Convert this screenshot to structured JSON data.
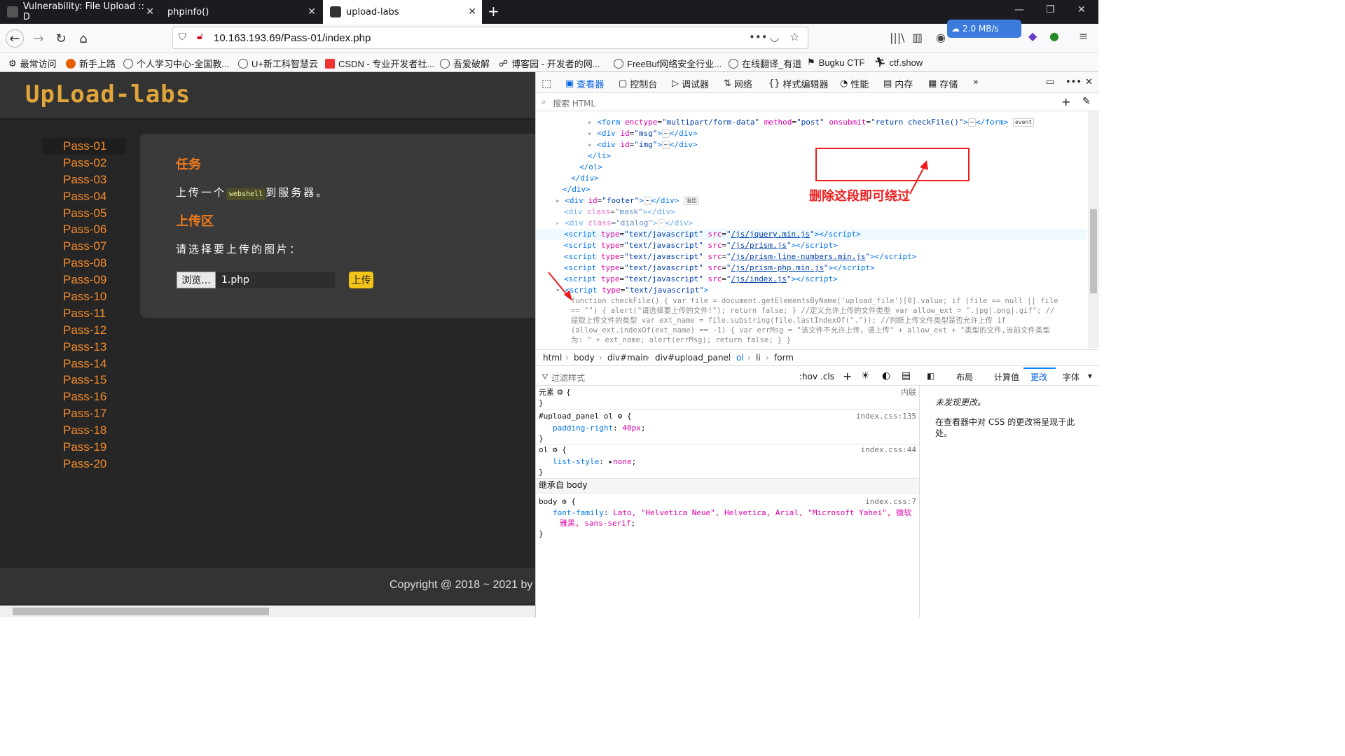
{
  "tabs": [
    {
      "label": "Vulnerability: File Upload :: D"
    },
    {
      "label": "phpinfo()"
    },
    {
      "label": "upload-labs"
    }
  ],
  "url": "10.163.193.69/Pass-01/index.php",
  "speed_badge": "2.0 MB/s",
  "bookmarks": [
    "最常访问",
    "新手上路",
    "个人学习中心-全国教...",
    "U+新工科智慧云",
    "CSDN - 专业开发者社...",
    "吾爱破解",
    "博客园 - 开发者的网...",
    "FreeBuf网络安全行业...",
    "在线翻译_有道",
    "Bugku CTF",
    "ctf.show"
  ],
  "site": {
    "logo": "UpLoad-labs",
    "passes": [
      "Pass-01",
      "Pass-02",
      "Pass-03",
      "Pass-04",
      "Pass-05",
      "Pass-06",
      "Pass-07",
      "Pass-08",
      "Pass-09",
      "Pass-10",
      "Pass-11",
      "Pass-12",
      "Pass-13",
      "Pass-14",
      "Pass-15",
      "Pass-16",
      "Pass-17",
      "Pass-18",
      "Pass-19",
      "Pass-20"
    ],
    "task_heading": "任务",
    "task_pre": "上传一个",
    "task_code": "webshell",
    "task_post": "到服务器。",
    "upload_heading": "上传区",
    "choose_label": "请选择要上传的图片：",
    "browse_label": "浏览...",
    "file_name": "1.php",
    "upload_button": "上传",
    "copyright": "Copyright @ 2018 ~ 2021 by"
  },
  "devtools": {
    "tools": [
      "查看器",
      "控制台",
      "调试器",
      "网络",
      "样式编辑器",
      "性能",
      "内存",
      "存储"
    ],
    "search_placeholder": "搜索 HTML",
    "annotation": "删除这段即可绕过",
    "breadcrumbs": [
      "html",
      "body",
      "div#main",
      "div#upload_panel",
      "ol",
      "li",
      "form"
    ],
    "filter_placeholder": "过滤样式",
    "hov": ":hov",
    "cls": ".cls",
    "right_tabs": [
      "布局",
      "计算值",
      "更改",
      "字体"
    ],
    "no_changes": "未发现更改。",
    "changes_hint": "在查看器中对 CSS 的更改将呈现于此处。",
    "inherit": "继承自 body",
    "element_label": "元素",
    "inline": "内联",
    "rule1_sel": "#upload_panel ol",
    "rule1_src": "index.css:135",
    "rule1_prop": "padding-right",
    "rule1_val": "40px",
    "rule2_sel": "ol",
    "rule2_src": "index.css:44",
    "rule2_prop": "list-style",
    "rule2_val": "none",
    "rule3_sel": "body",
    "rule3_src": "index.css:7",
    "rule3_prop": "font-family",
    "rule3_val1": "Lato, \"Helvetica Neue\", Helvetica, Arial, \"Microsoft Yahei\", 微软",
    "rule3_val2": "雅黑, sans-serif",
    "js_line1": "function checkFile() { var file = document.getElementsByName('upload_file')[0].value; if (file == null || file",
    "js_line2": "== \"\") { alert(\"请选择要上传的文件!\"); return false; } //定义允许上传的文件类型 var allow_ext = \".jpg|.png|.gif\"; //",
    "js_line3": "提取上传文件的类型 var ext_name = file.substring(file.lastIndexOf(\".\")); //判断上传文件类型是否允许上传 if",
    "js_line4": "(allow_ext.indexOf(ext_name) == -1) { var errMsg = \"该文件不允许上传，请上传\" + allow_ext + \"类型的文件,当前文件类型",
    "js_line5": "为: \" + ext_name; alert(errMsg); return false; } }"
  }
}
